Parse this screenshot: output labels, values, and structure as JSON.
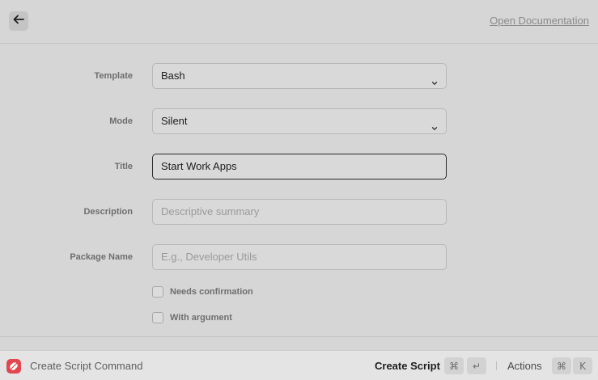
{
  "header": {
    "back_icon": "arrow-left-icon",
    "doc_link": "Open Documentation"
  },
  "form": {
    "template": {
      "label": "Template",
      "value": "Bash"
    },
    "mode": {
      "label": "Mode",
      "value": "Silent"
    },
    "title": {
      "label": "Title",
      "value": "Start Work Apps"
    },
    "description": {
      "label": "Description",
      "placeholder": "Descriptive summary"
    },
    "package_name": {
      "label": "Package Name",
      "placeholder": "E.g., Developer Utils"
    },
    "needs_confirmation": {
      "label": "Needs confirmation",
      "checked": false
    },
    "with_argument": {
      "label": "With argument",
      "checked": false
    }
  },
  "footer": {
    "app_icon": "raycast-icon",
    "title": "Create Script Command",
    "primary_action": "Create Script",
    "primary_shortcut": [
      "⌘",
      "↵"
    ],
    "actions_label": "Actions",
    "actions_shortcut": [
      "⌘",
      "K"
    ]
  },
  "colors": {
    "background": "#d6d6d6",
    "footer_background": "#e4e4e4",
    "accent": "#e2474f"
  }
}
